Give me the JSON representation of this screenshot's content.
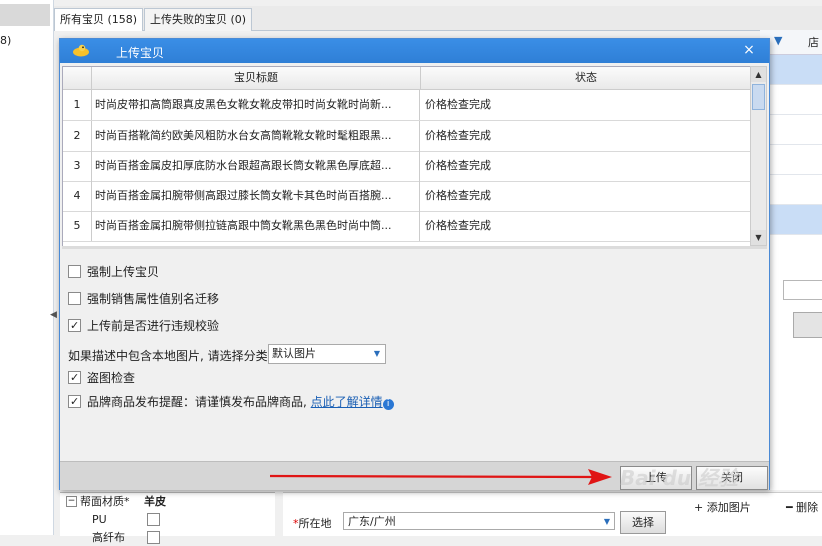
{
  "background": {
    "left_count": "8)",
    "tabs": [
      {
        "label": "所有宝贝 (158)"
      },
      {
        "label": "上传失败的宝贝 (0)"
      }
    ],
    "grid_col": "店",
    "attributes": {
      "group": "帮面材质*",
      "group_value": "羊皮",
      "rows": [
        {
          "label": "PU"
        },
        {
          "label": "高纤布"
        }
      ]
    },
    "location": {
      "label": "所在地",
      "value": "广东/广州",
      "choose": "选择"
    },
    "images": {
      "add": "+ 添加图片",
      "delete": "━ 删除"
    }
  },
  "dialog": {
    "title": "上传宝贝",
    "close": "×",
    "columns": [
      "宝贝标题",
      "状态"
    ],
    "rows": [
      {
        "num": "1",
        "title": "时尚皮带扣高筒跟真皮黑色女靴女靴皮带扣时尚女靴时尚新...",
        "status": "价格检查完成"
      },
      {
        "num": "2",
        "title": "时尚百搭靴简约欧美风粗防水台女高筒靴靴女靴时髦粗跟黑...",
        "status": "价格检查完成"
      },
      {
        "num": "3",
        "title": "时尚百搭金属皮扣厚底防水台跟超高跟长筒女靴黑色厚底超...",
        "status": "价格检查完成"
      },
      {
        "num": "4",
        "title": "时尚百搭金属扣腕带侧高跟过膝长筒女靴卡其色时尚百搭腕...",
        "status": "价格检查完成"
      },
      {
        "num": "5",
        "title": "时尚百搭金属扣腕带侧拉链高跟中筒女靴黑色黑色时尚中筒...",
        "status": "价格检查完成"
      }
    ],
    "options": {
      "force_upload": "强制上传宝贝",
      "force_sale_attr": "强制销售属性值别名迁移",
      "violation_check": "上传前是否进行违规校验",
      "category_prompt": "如果描述中包含本地图片, 请选择分类",
      "category_value": "默认图片",
      "anti_theft": "盗图检查",
      "brand_notice": "品牌商品发布提醒：请谨慎发布品牌商品,",
      "detail_link": "点此了解详情"
    },
    "checks": {
      "force_upload": false,
      "force_sale_attr": false,
      "violation_check": true,
      "anti_theft": true,
      "brand_notice": true
    },
    "buttons": {
      "upload": "上传",
      "close": "关闭"
    }
  },
  "watermark": "Bai du 经验",
  "colors": {
    "titlebar": "#3a8ee6",
    "arrow": "#e01515",
    "link": "#1a5fb4"
  }
}
